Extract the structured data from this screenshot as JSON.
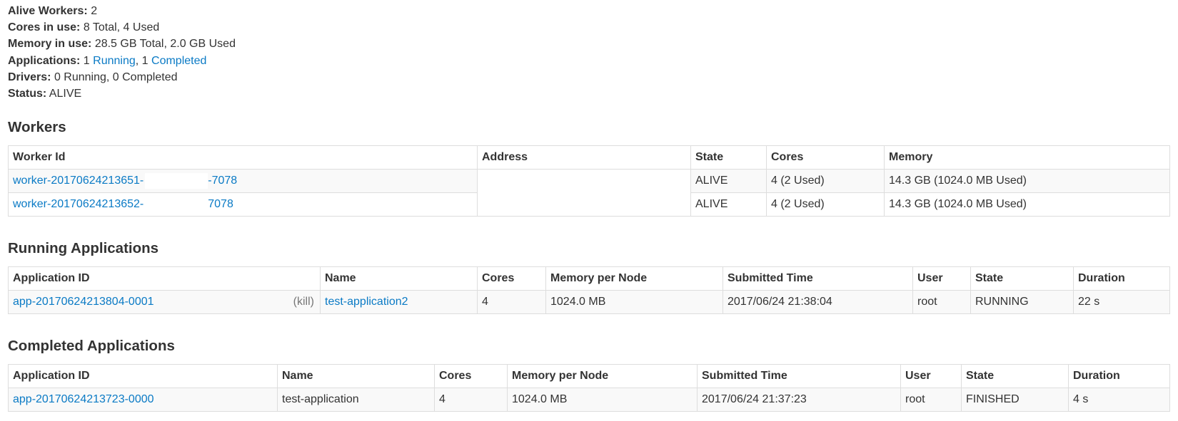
{
  "summary": {
    "alive_workers_label": "Alive Workers:",
    "alive_workers_value": "2",
    "cores_label": "Cores in use:",
    "cores_value": "8 Total, 4 Used",
    "memory_label": "Memory in use:",
    "memory_value": "28.5 GB Total, 2.0 GB Used",
    "applications_label": "Applications:",
    "applications_running_count": "1",
    "applications_running_link": "Running",
    "applications_sep": ", 1",
    "applications_completed_link": "Completed",
    "drivers_label": "Drivers:",
    "drivers_value": "0 Running, 0 Completed",
    "status_label": "Status:",
    "status_value": "ALIVE"
  },
  "workers": {
    "title": "Workers",
    "columns": [
      "Worker Id",
      "Address",
      "State",
      "Cores",
      "Memory"
    ],
    "rows": [
      {
        "id_prefix": "worker-20170624213651-",
        "id_suffix": "-7078",
        "address": "",
        "state": "ALIVE",
        "cores": "4 (2 Used)",
        "memory": "14.3 GB (1024.0 MB Used)"
      },
      {
        "id_prefix": "worker-20170624213652-",
        "id_suffix": "7078",
        "address": "",
        "state": "ALIVE",
        "cores": "4 (2 Used)",
        "memory": "14.3 GB (1024.0 MB Used)"
      }
    ]
  },
  "running_apps": {
    "title": "Running Applications",
    "columns": [
      "Application ID",
      "Name",
      "Cores",
      "Memory per Node",
      "Submitted Time",
      "User",
      "State",
      "Duration"
    ],
    "rows": [
      {
        "app_id": "app-20170624213804-0001",
        "kill": "(kill)",
        "name": "test-application2",
        "cores": "4",
        "memory": "1024.0 MB",
        "submitted": "2017/06/24 21:38:04",
        "user": "root",
        "state": "RUNNING",
        "duration": "22 s"
      }
    ]
  },
  "completed_apps": {
    "title": "Completed Applications",
    "columns": [
      "Application ID",
      "Name",
      "Cores",
      "Memory per Node",
      "Submitted Time",
      "User",
      "State",
      "Duration"
    ],
    "rows": [
      {
        "app_id": "app-20170624213723-0000",
        "name": "test-application",
        "cores": "4",
        "memory": "1024.0 MB",
        "submitted": "2017/06/24 21:37:23",
        "user": "root",
        "state": "FINISHED",
        "duration": "4 s"
      }
    ]
  }
}
